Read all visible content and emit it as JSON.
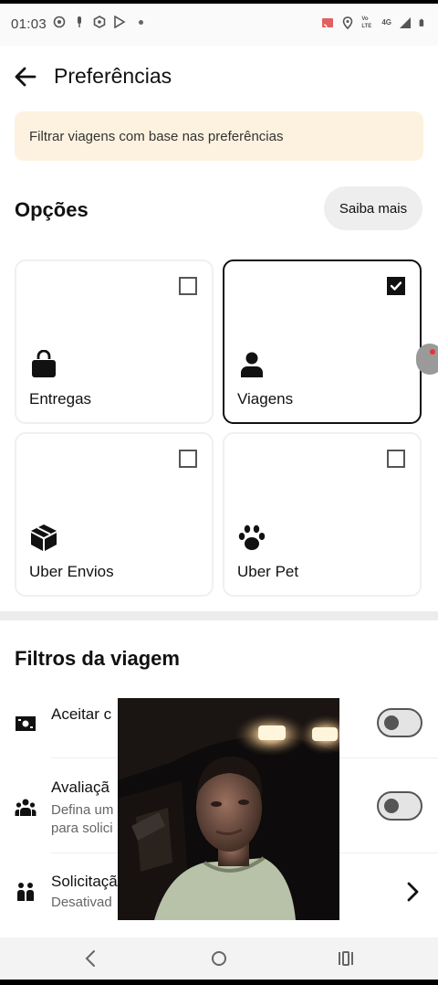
{
  "status_bar": {
    "time": "01:03",
    "network_label": "4G",
    "volte_label": "Vo LTE"
  },
  "header": {
    "title": "Preferências"
  },
  "banner": {
    "text": "Filtrar viagens com base nas preferências"
  },
  "options": {
    "title": "Opções",
    "learn_more": "Saiba mais",
    "cards": [
      {
        "label": "Entregas",
        "icon": "shopping-bag-icon",
        "checked": false
      },
      {
        "label": "Viagens",
        "icon": "person-icon",
        "checked": true
      },
      {
        "label": "Uber Envios",
        "icon": "package-icon",
        "checked": false
      },
      {
        "label": "Uber Pet",
        "icon": "paw-icon",
        "checked": false
      }
    ]
  },
  "filters": {
    "title": "Filtros da viagem",
    "rows": [
      {
        "title": "Aceitar c",
        "icon": "cash-icon",
        "control": "toggle",
        "on": false
      },
      {
        "title": "Avaliaçã",
        "subtitle_1": "Defina um",
        "subtitle_2": "para solici",
        "icon": "group-icon",
        "control": "toggle",
        "on": false
      },
      {
        "title": "Solicitaçã",
        "subtitle_1": "Desativad",
        "icon": "people-icon",
        "control": "chevron"
      }
    ]
  },
  "colors": {
    "banner_bg": "#fcf2df",
    "selected_border": "#111111",
    "divider": "#ececec"
  },
  "nav_bar": {
    "icons": [
      "back-nav-icon",
      "home-nav-icon",
      "recents-nav-icon"
    ]
  }
}
